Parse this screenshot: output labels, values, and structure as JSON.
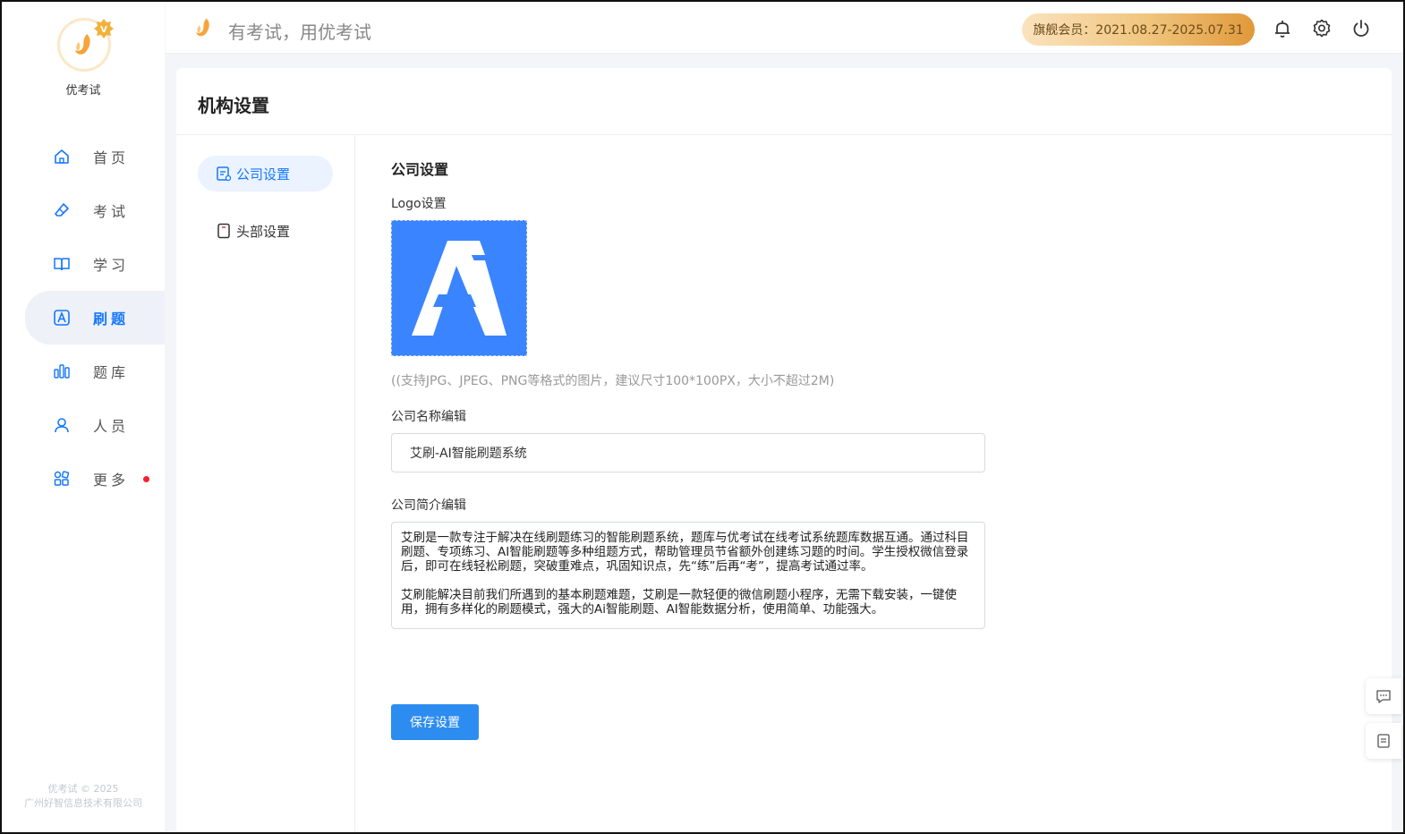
{
  "brand": {
    "name": "优考试",
    "copyright_line1": "优考试 © 2025",
    "copyright_line2": "广州好智信息技术有限公司"
  },
  "sidebar": {
    "items": [
      {
        "label": "首页",
        "icon": "home-icon",
        "active": false
      },
      {
        "label": "考试",
        "icon": "eraser-icon",
        "active": false
      },
      {
        "label": "学习",
        "icon": "book-icon",
        "active": false
      },
      {
        "label": "刷题",
        "icon": "letter-a-icon",
        "active": true
      },
      {
        "label": "题库",
        "icon": "bars-icon",
        "active": false
      },
      {
        "label": "人员",
        "icon": "user-icon",
        "active": false
      },
      {
        "label": "更多",
        "icon": "apps-icon",
        "active": false,
        "dot": true
      }
    ]
  },
  "header": {
    "slogan": "有考试，用优考试",
    "membership": "旗舰会员：2021.08.27-2025.07.31"
  },
  "page": {
    "title": "机构设置",
    "tabs": [
      {
        "label": "公司设置",
        "active": true
      },
      {
        "label": "头部设置",
        "active": false
      }
    ]
  },
  "form": {
    "section_title": "公司设置",
    "logo_label": "Logo设置",
    "logo_hint": "((支持JPG、JPEG、PNG等格式的图片，建议尺寸100*100PX，大小不超过2M)",
    "name_label": "公司名称编辑",
    "name_value": "艾刷-AI智能刷题系统",
    "intro_label": "公司简介编辑",
    "intro_p1": "艾刷是一款专注于解决在线刷题练习的智能刷题系统，题库与优考试在线考试系统题库数据互通。通过科目刷题、专项练习、AI智能刷题等多种组题方式，帮助管理员节省额外创建练习题的时间。学生授权微信登录后，即可在线轻松刷题，突破重难点，巩固知识点，先“练”后再“考”，提高考试通过率。",
    "intro_p2": "艾刷能解决目前我们所遇到的基本刷题难题，艾刷是一款轻便的微信刷题小程序，无需下载安装，一键使用，拥有多样化的刷题模式，强大的Ai智能刷题、AI智能数据分析，使用简单、功能强大。",
    "save_label": "保存设置"
  },
  "colors": {
    "accent": "#1677ff",
    "logo_bg": "#3a84ff",
    "button": "#2d8cf0"
  }
}
